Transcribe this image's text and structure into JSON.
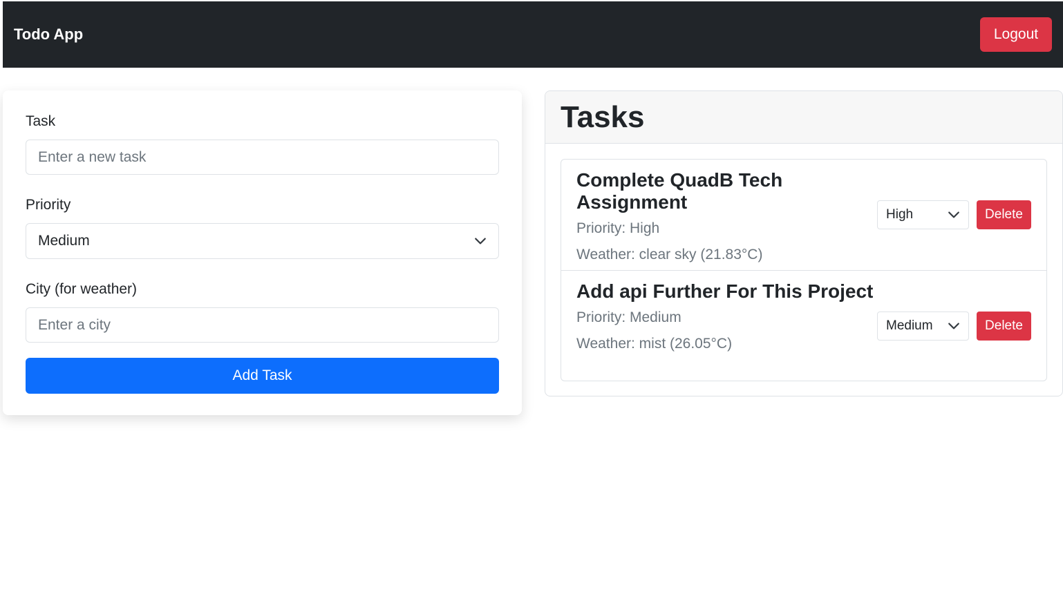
{
  "navbar": {
    "brand": "Todo App",
    "logout_label": "Logout"
  },
  "form": {
    "task_label": "Task",
    "task_placeholder": "Enter a new task",
    "task_value": "",
    "priority_label": "Priority",
    "priority_value": "Medium",
    "city_label": "City (for weather)",
    "city_placeholder": "Enter a city",
    "city_value": "",
    "add_button_label": "Add Task"
  },
  "tasks": {
    "title": "Tasks",
    "items": [
      {
        "title": "Complete QuadB Tech Assignment",
        "priority_text": "Priority: High",
        "weather_text": "Weather: clear sky (21.83°C)",
        "priority_select": "High",
        "delete_label": "Delete"
      },
      {
        "title": "Add api Further For This Project",
        "priority_text": "Priority: Medium",
        "weather_text": "Weather: mist (26.05°C)",
        "priority_select": "Medium",
        "delete_label": "Delete"
      }
    ]
  },
  "colors": {
    "navbar_bg": "#212529",
    "danger": "#dc3545",
    "primary": "#0d6efd",
    "muted_text": "#6c757d"
  },
  "icons": {
    "select_arrow": "chevron-down-icon"
  }
}
